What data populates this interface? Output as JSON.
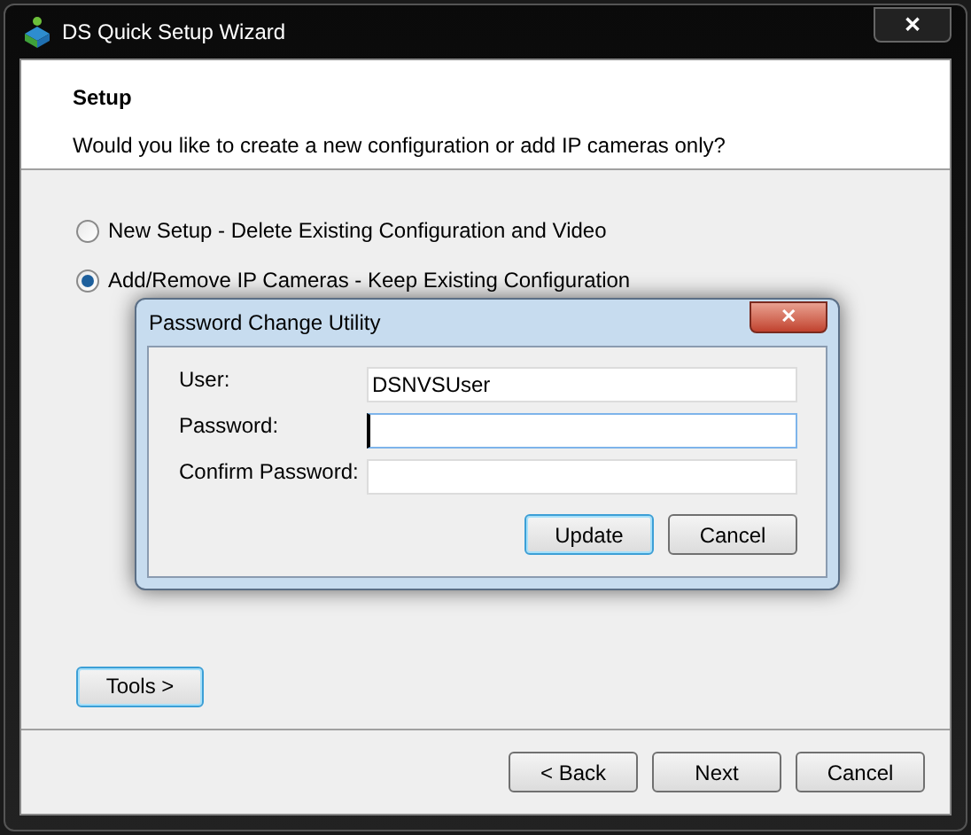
{
  "window": {
    "title": "DS Quick Setup Wizard",
    "close": "✕"
  },
  "header": {
    "title": "Setup",
    "subtitle": "Would you like to create a new configuration or add IP cameras only?"
  },
  "options": [
    {
      "label": "New Setup - Delete Existing Configuration and Video",
      "selected": false
    },
    {
      "label": "Add/Remove IP Cameras - Keep Existing Configuration",
      "selected": true
    }
  ],
  "tools_button": {
    "label": "Tools >",
    "focused": true
  },
  "footer_buttons": [
    {
      "label": "< Back",
      "focused": false
    },
    {
      "label": "Next",
      "focused": false
    },
    {
      "label": "Cancel",
      "focused": false
    }
  ],
  "dialog": {
    "title": "Password Change Utility",
    "close": "✕",
    "fields": [
      {
        "label": "User:",
        "value": "DSNVSUser",
        "focused": false
      },
      {
        "label": "Password:",
        "focused": true
      },
      {
        "label": "Confirm Password:",
        "focused": false
      }
    ],
    "buttons": [
      {
        "label": "Update",
        "focused": true
      },
      {
        "label": "Cancel",
        "focused": false
      }
    ]
  }
}
